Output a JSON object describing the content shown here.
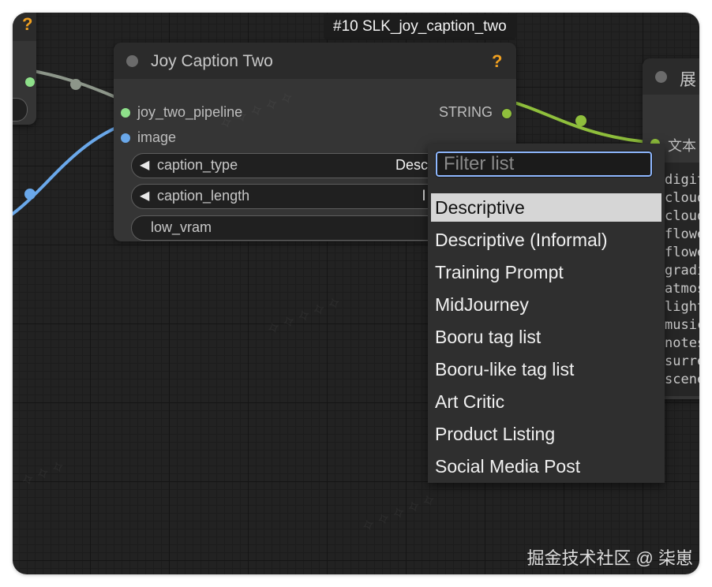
{
  "tooltip": {
    "text": "#10 SLK_joy_caption_two"
  },
  "main_node": {
    "title": "Joy Caption Two",
    "help": "?",
    "inputs": [
      {
        "label": "joy_two_pipeline",
        "color": "#8ee08a"
      },
      {
        "label": "image",
        "color": "#6aa8ea"
      }
    ],
    "output": {
      "label": "STRING",
      "color": "#8fbf3c"
    },
    "widgets": [
      {
        "label": "caption_type",
        "value": "Descripti",
        "arrow": "◀"
      },
      {
        "label": "caption_length",
        "value": "l",
        "arrow": "◀"
      },
      {
        "label": "low_vram",
        "value": ""
      }
    ]
  },
  "left_node": {
    "help": "?"
  },
  "right_node": {
    "title": "展",
    "input_label": "文本",
    "text_lines": [
      "digit",
      "cloud",
      "cloud",
      "flowe",
      "flowe",
      "gradi",
      "atmos",
      "light",
      "music",
      "notes",
      "surre",
      "scene"
    ]
  },
  "dropdown": {
    "filter_placeholder": "Filter list",
    "filter_value": "",
    "items": [
      "Descriptive",
      "Descriptive (Informal)",
      "Training Prompt",
      "MidJourney",
      "Booru tag list",
      "Booru-like tag list",
      "Art Critic",
      "Product Listing",
      "Social Media Post"
    ],
    "selected_index": 0
  },
  "credit": "掘金技术社区 @ 柒崽",
  "colors": {
    "link_gray": "#8d968a",
    "link_blue": "#6aa8ea",
    "link_green": "#8fbf3c",
    "accent_help": "#f0a020"
  }
}
